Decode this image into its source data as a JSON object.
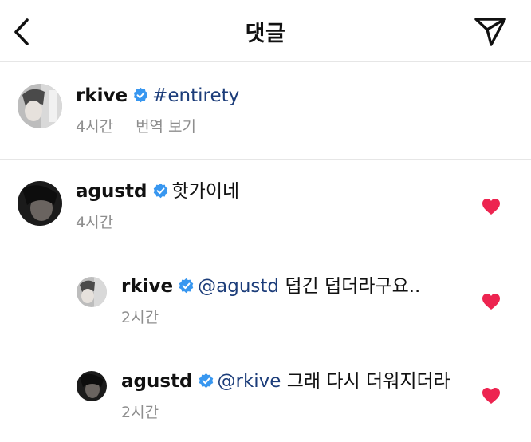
{
  "header": {
    "title": "댓글",
    "back_icon": "chevron-left-icon",
    "send_icon": "paper-plane-icon"
  },
  "caption": {
    "username": "rkive",
    "text": "#entirety",
    "time": "4시간",
    "translate": "번역 보기"
  },
  "comments": [
    {
      "username": "agustd",
      "mention": "",
      "text": "핫가이네",
      "time": "4시간",
      "liked": true
    },
    {
      "username": "rkive",
      "mention": "@agustd",
      "text": "덥긴 덥더라구요..",
      "time": "2시간",
      "liked": true
    },
    {
      "username": "agustd",
      "mention": "@rkive",
      "text": "그래 다시 더워지더라",
      "time": "2시간",
      "liked": true
    }
  ],
  "colors": {
    "verified": "#3897f0",
    "heart": "#ed2450",
    "link": "#1c3d7a",
    "meta": "#8e8e8e",
    "divider": "#e6e6e6"
  }
}
